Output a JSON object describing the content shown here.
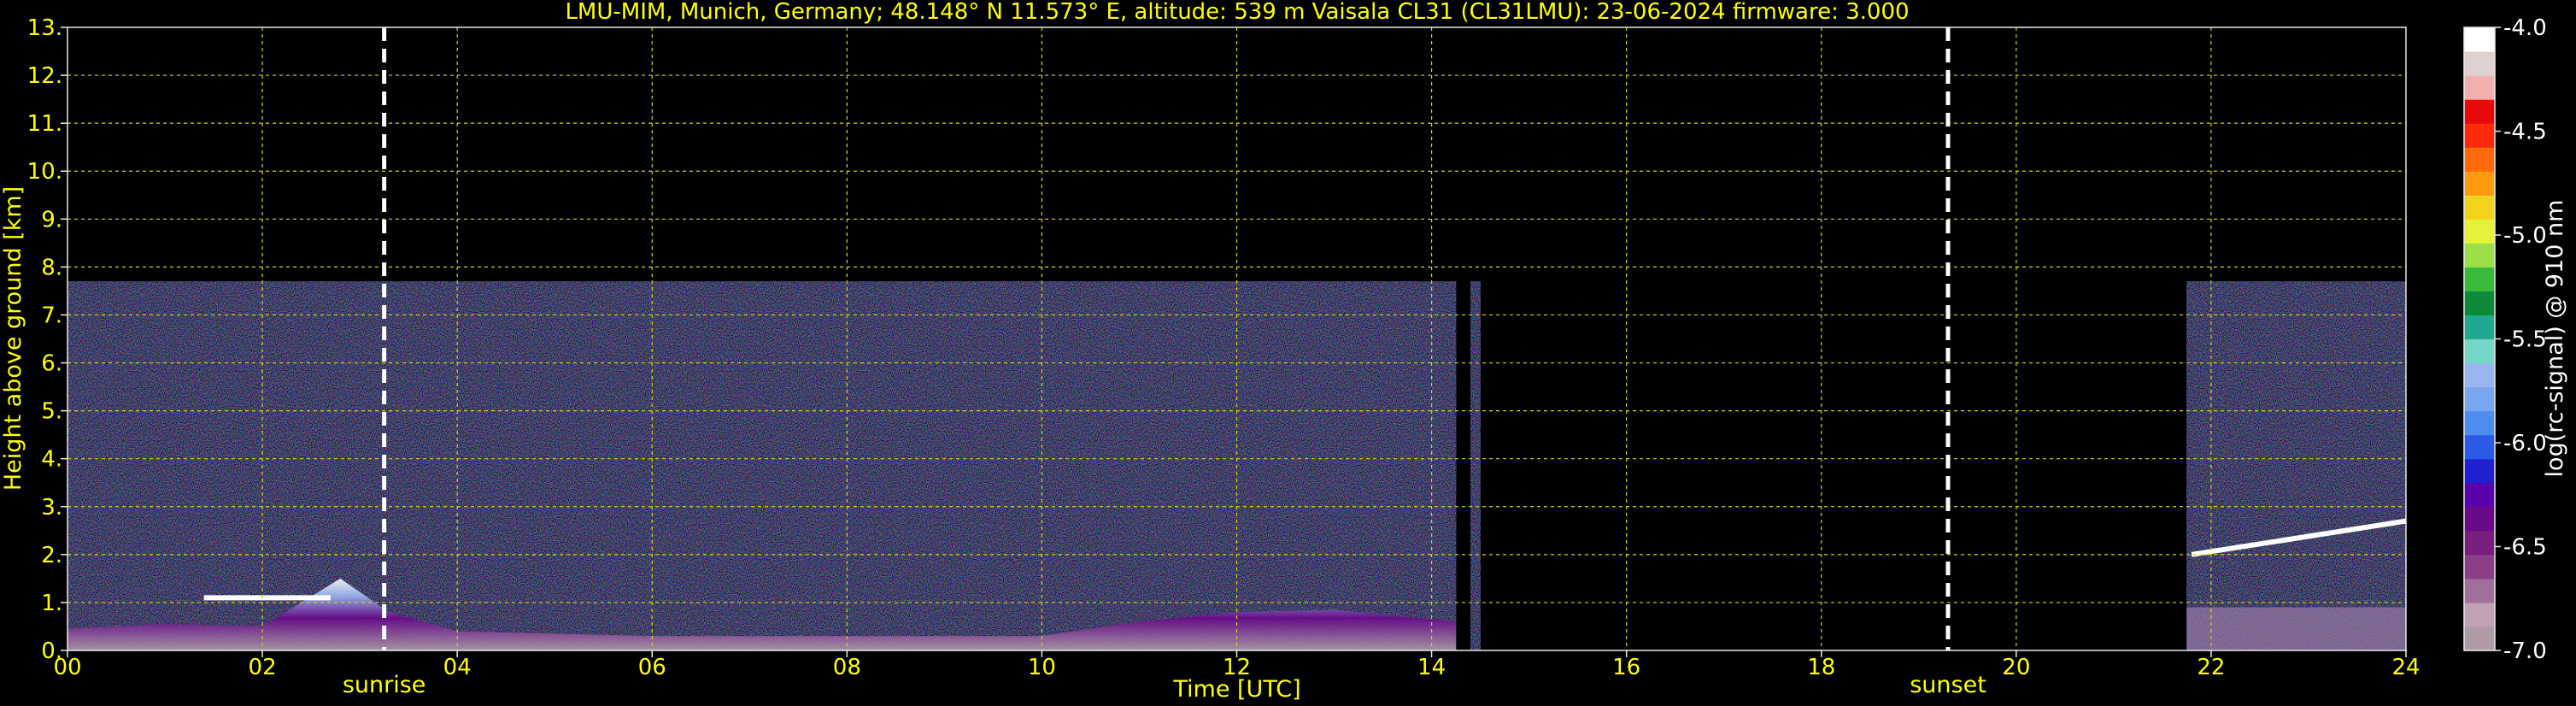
{
  "chart_data": {
    "type": "heatmap",
    "title": "LMU-MIM, Munich, Germany; 48.148° N 11.573° E, altitude: 539 m    Vaisala CL31 (CL31LMU): 23-06-2024    firmware: 3.000",
    "xlabel": "Time [UTC]",
    "ylabel": "Height above ground [km]",
    "xlim": [
      0,
      24
    ],
    "ylim": [
      0,
      13
    ],
    "x_ticks": [
      "00",
      "02",
      "04",
      "06",
      "08",
      "10",
      "12",
      "14",
      "16",
      "18",
      "20",
      "22",
      "24"
    ],
    "y_ticks": [
      "0.",
      "1.",
      "2.",
      "3.",
      "4.",
      "5.",
      "6.",
      "7.",
      "8.",
      "9.",
      "10.",
      "11.",
      "12.",
      "13."
    ],
    "grid": true,
    "events": [
      {
        "name": "sunrise",
        "time": 3.25
      },
      {
        "name": "sunset",
        "time": 19.3
      }
    ],
    "data_segments": [
      {
        "start": 0.0,
        "end": 14.25,
        "top_km": 7.7
      },
      {
        "start": 14.4,
        "end": 14.5,
        "top_km": 7.7
      },
      {
        "start": 21.75,
        "end": 24.0,
        "top_km": 7.7
      }
    ],
    "aerosol_layer_top_km": [
      {
        "time": 0.0,
        "height": 0.45
      },
      {
        "time": 1.0,
        "height": 0.55
      },
      {
        "time": 2.0,
        "height": 0.5
      },
      {
        "time": 2.8,
        "height": 1.5
      },
      {
        "time": 3.3,
        "height": 0.8
      },
      {
        "time": 4.0,
        "height": 0.4
      },
      {
        "time": 6.0,
        "height": 0.3
      },
      {
        "time": 8.0,
        "height": 0.3
      },
      {
        "time": 10.0,
        "height": 0.3
      },
      {
        "time": 11.0,
        "height": 0.6
      },
      {
        "time": 12.0,
        "height": 0.8
      },
      {
        "time": 13.0,
        "height": 0.85
      }
    ],
    "cloud_layers": [
      {
        "start": 1.4,
        "end": 2.7,
        "height": 1.1
      },
      {
        "start": 21.8,
        "end": 24.0,
        "height_start": 2.0,
        "height_end": 2.7
      }
    ],
    "colorbar": {
      "label": "log(rc-signal) @ 910 nm",
      "min": -7.0,
      "max": -4.0,
      "ticks": [
        "-4.0",
        "-4.5",
        "-5.0",
        "-5.5",
        "-6.0",
        "-6.5",
        "-7.0"
      ],
      "colors": [
        "#b09aa8",
        "#c0a2b6",
        "#a0709a",
        "#8a3f88",
        "#7a1e7e",
        "#6a0a8a",
        "#5a00aa",
        "#2020d0",
        "#2a5ae6",
        "#4f8cf0",
        "#7aa6f0",
        "#9ab4f0",
        "#78d6c8",
        "#20a890",
        "#0a8a3a",
        "#3aba3a",
        "#9ade4a",
        "#e6f23a",
        "#f2d21a",
        "#ff9a10",
        "#ff6a0a",
        "#ff2a0a",
        "#e80a0a",
        "#f0b0b0",
        "#e0d0d0",
        "#ffffff"
      ]
    },
    "event_labels": [
      "sunrise",
      "sunset"
    ]
  }
}
